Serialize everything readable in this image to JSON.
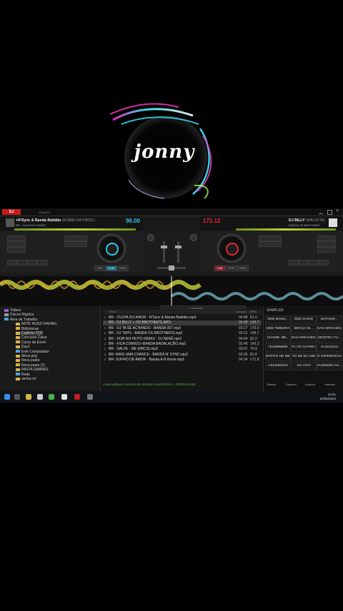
{
  "logo": {
    "text": "jonny"
  },
  "app": {
    "name": "DJ",
    "window_title": "VirtualDJ"
  },
  "deck_left": {
    "title": "+N'Sync & Banda Batidão",
    "title_suffix": "(KOMBI DA PROD.)",
    "subtitle": "BR - CULPA DO AMOR",
    "bpm": "96.00",
    "color": "#2ec7e6",
    "buttons": [
      "CUE",
      "PLAY",
      "SYNC"
    ]
  },
  "deck_right": {
    "title": "DJ BILLY",
    "title_suffix": "(MACIOTA)",
    "subtitle": "BANDA OS BROTHERS",
    "bpm": "172.12",
    "color": "#e0263a",
    "buttons": [
      "CUE",
      "PLAY",
      "SYNC"
    ]
  },
  "folders": [
    {
      "label": "Vídeos",
      "color": "#9b5de5"
    },
    {
      "label": "Discos Rígidos",
      "color": "#9aa0a6"
    },
    {
      "label": "Área de Trabalho",
      "color": "#4aa3df"
    },
    {
      "label": "ARTE HUGO RAFAEL",
      "color": "#d8b24a"
    },
    {
      "label": "Bibliotecas",
      "color": "#d8b24a"
    },
    {
      "label": "Cadinho TOP",
      "color": "#d8b24a",
      "selected": true
    },
    {
      "label": "Concurso Caixa",
      "color": "#d8b24a"
    },
    {
      "label": "Curso de Excel",
      "color": "#d8b24a"
    },
    {
      "label": "DayZ",
      "color": "#d8b24a"
    },
    {
      "label": "Este Computador",
      "color": "#4aa3df"
    },
    {
      "label": "Meus.png",
      "color": "#d8b24a"
    },
    {
      "label": "Nova pasta",
      "color": "#d8b24a"
    },
    {
      "label": "Nova pasta (2)",
      "color": "#d8b24a"
    },
    {
      "label": "PASTA GABRIEL",
      "color": "#d8b24a"
    },
    {
      "label": "Rede",
      "color": "#4aa3df"
    },
    {
      "label": "senha roi",
      "color": "#d8b24a"
    }
  ],
  "tracks": {
    "search_placeholder": "9 arquivos",
    "columns": {
      "title": "Título",
      "duration": "Duração",
      "bpm": "BPM"
    },
    "rows": [
      {
        "title": "BR - CULPA DO AMOR - N'Sync & Banda Batidão.mp3",
        "duration": "04:48",
        "bpm": "81.0"
      },
      {
        "title": "BR - DJ BILLY + OS BROTHER'S.MP3",
        "duration": "04:48",
        "bpm": "149.7",
        "highlight": true
      },
      {
        "title": "BR - DJ TA SE ACHANDO - BANDA 007.mp3",
        "duration": "03:27",
        "bpm": "170.0"
      },
      {
        "title": "BR - DJ TAPO - BANDA OS BROTHER'S.mp3",
        "duration": "03:21",
        "bpm": "148.7"
      },
      {
        "title": "BR - DOR NO PEITO REMIX - DJ NENÊ.mp3",
        "duration": "04:04",
        "bpm": "82.0"
      },
      {
        "title": "BR - FICA COMIGO--BANDA BADALAÇÃO.mp3",
        "duration": "03:48",
        "bpm": "149.3"
      },
      {
        "title": "BR - SALVE - ME (RBCS).mp3",
        "duration": "03:07",
        "bpm": "79.9"
      },
      {
        "title": "BR- MAIS UMA CHANCE - BANDA N' SYNC.mp3",
        "duration": "03:36",
        "bpm": "81.8"
      },
      {
        "title": "BR- SOFRO DE AMOR - Banda A.R.Kinze.mp3",
        "duration": "04:24",
        "bpm": "171.8"
      }
    ],
    "status": "LiveFeedback recomenda: BANDA AMAZONAS - PERDOA-ME"
  },
  "sampler": {
    "title": "SAMPLER",
    "pads": [
      "VEM MAMA...",
      "ÉÉÉ SHOW",
      "BATOUR...",
      "VEM TIMBORA",
      "BRAÇA IN...",
      "NAS MIRAGEN...",
      "CHAME- BB...",
      "NAS MIRAGEN...",
      "MOSTRA TU...",
      "HUMMMMM",
      "TA OK GATINH...",
      "UUUUUUU",
      "EFEITO HE MEM",
      "TO NE DA SIM",
      "O DIFERENCIA",
      "ASSOBOOO",
      "AO VIVO",
      "FAZENDO AS..."
    ],
    "tabs": [
      "Sidebar",
      "Sampler",
      "Automix",
      "Karaoke"
    ]
  },
  "taskbar": {
    "time": "12:41",
    "date": "22/06/2024"
  }
}
